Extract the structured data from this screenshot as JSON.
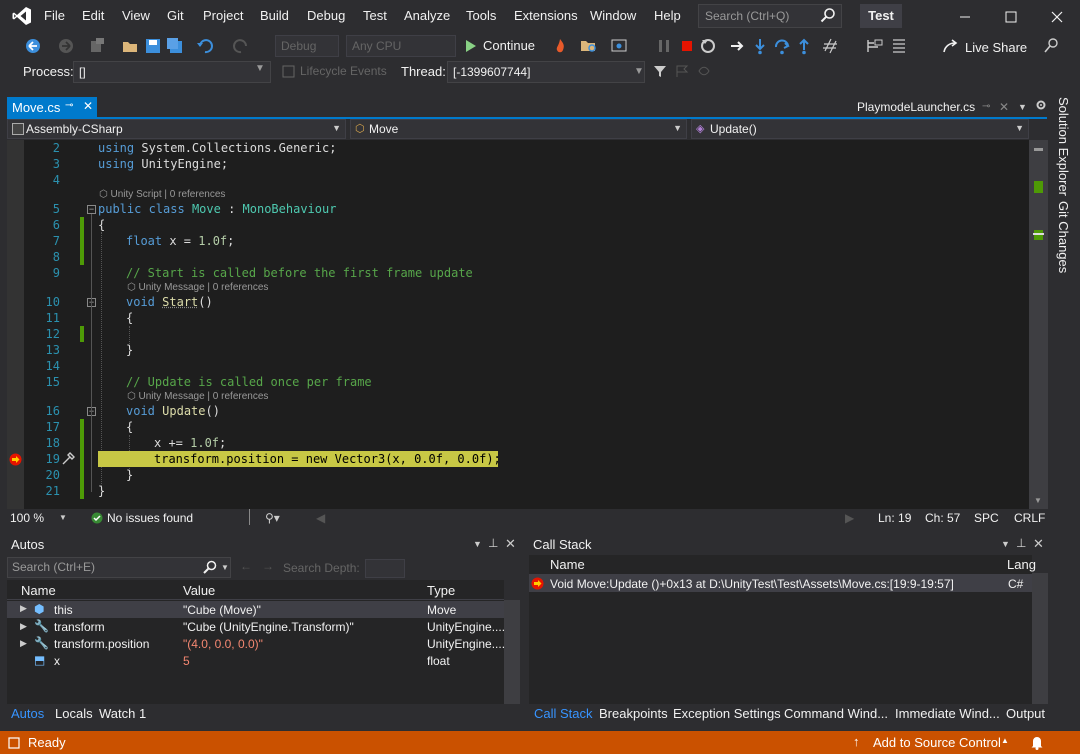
{
  "menu": {
    "items": [
      "File",
      "Edit",
      "View",
      "Git",
      "Project",
      "Build",
      "Debug",
      "Test",
      "Analyze",
      "Tools",
      "Extensions",
      "Window",
      "Help"
    ],
    "search_placeholder": "Search (Ctrl+Q)",
    "solution_name": "Test"
  },
  "toolbar": {
    "configuration": "Debug",
    "platform": "Any CPU",
    "continue_label": "Continue",
    "live_share_label": "Live Share"
  },
  "debug_location": {
    "process_label": "Process:",
    "process_value": "[]",
    "lifecycle_label": "Lifecycle Events",
    "thread_label": "Thread:",
    "thread_value": "[-1399607744]"
  },
  "document_tabs": {
    "active": "Move.cs",
    "other": "PlaymodeLauncher.cs"
  },
  "navigation": {
    "project": "Assembly-CSharp",
    "type": "Move",
    "member": "Update()"
  },
  "code": {
    "line_numbers": [
      "2",
      "3",
      "4",
      "5",
      "6",
      "7",
      "8",
      "9",
      "10",
      "11",
      "12",
      "13",
      "14",
      "15",
      "16",
      "17",
      "18",
      "19",
      "20",
      "21"
    ],
    "lens_class": "Unity Script | 0 references",
    "lens_start": "Unity Message | 0 references",
    "lens_update": "Unity Message | 0 references",
    "tokens": {
      "using": "using",
      "ns1": " System.Collections.Generic;",
      "ns2": " UnityEngine;",
      "public": "public",
      "class": " class ",
      "classname": "Move",
      "colon": " : ",
      "base": "MonoBehaviour",
      "open_brace": "{",
      "close_brace": "}",
      "float": "float",
      "x_decl": " x = ",
      "float_val": "1.0f",
      "semi": ";",
      "comment_start": "// Start is called before the first frame update",
      "void": "void",
      "start_name": "Start",
      "parens": "()",
      "comment_update": "// Update is called once per frame",
      "update_name": "Update",
      "x_inc": "x += ",
      "current_line": "transform.position = new Vector3(x, 0.0f, 0.0f);"
    }
  },
  "editor_status": {
    "zoom": "100 %",
    "issues": "No issues found",
    "line": "Ln: 19",
    "col": "Ch: 57",
    "spacing": "SPC",
    "line_ending": "CRLF"
  },
  "autos": {
    "title": "Autos",
    "search_placeholder": "Search (Ctrl+E)",
    "search_depth_label": "Search Depth:",
    "columns": [
      "Name",
      "Value",
      "Type"
    ],
    "rows": [
      {
        "name": "this",
        "value": "\"Cube (Move)\"",
        "type": "Move"
      },
      {
        "name": "transform",
        "value": "\"Cube (UnityEngine.Transform)\"",
        "type": "UnityEngine...."
      },
      {
        "name": "transform.position",
        "value": "\"(4.0, 0.0, 0.0)\"",
        "type": "UnityEngine...."
      },
      {
        "name": "x",
        "value": "5",
        "type": "float"
      }
    ],
    "tabs": [
      "Autos",
      "Locals",
      "Watch 1"
    ]
  },
  "call_stack": {
    "title": "Call Stack",
    "columns": [
      "Name",
      "Lang"
    ],
    "rows": [
      {
        "name": "Void Move:Update ()+0x13 at D:\\UnityTest\\Test\\Assets\\Move.cs:[19:9-19:57]",
        "lang": "C#"
      }
    ],
    "tabs": [
      "Call Stack",
      "Breakpoints",
      "Exception Settings",
      "Command Wind...",
      "Immediate Wind...",
      "Output"
    ]
  },
  "side_tabs": [
    "Solution Explorer",
    "Git Changes"
  ],
  "status": {
    "ready": "Ready",
    "source_control": "Add to Source Control"
  },
  "colors": {
    "accent": "#007acc",
    "status_bar": "#ca5100",
    "current_statement": "#c8c845",
    "change_marker": "#4e9a06"
  }
}
